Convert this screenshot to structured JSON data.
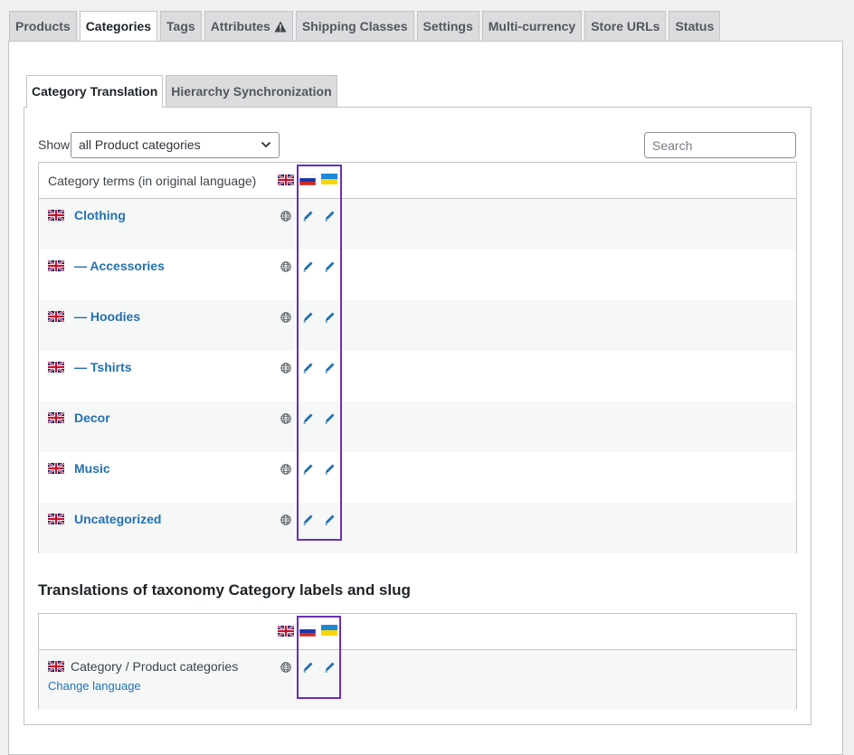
{
  "nav_tabs": [
    {
      "label": "Products",
      "active": false
    },
    {
      "label": "Categories",
      "active": true
    },
    {
      "label": "Tags",
      "active": false
    },
    {
      "label": "Attributes",
      "active": false,
      "icon": "warning-icon"
    },
    {
      "label": "Shipping Classes",
      "active": false
    },
    {
      "label": "Settings",
      "active": false
    },
    {
      "label": "Multi-currency",
      "active": false
    },
    {
      "label": "Store URLs",
      "active": false
    },
    {
      "label": "Status",
      "active": false
    }
  ],
  "sub_tabs": [
    {
      "label": "Category Translation",
      "active": true
    },
    {
      "label": "Hierarchy Synchronization",
      "active": false
    }
  ],
  "filter": {
    "show_label": "Show",
    "select_value": "all Product categories",
    "search_placeholder": "Search"
  },
  "terms_table": {
    "header": "Category terms (in original language)",
    "languages": [
      "en",
      "ru",
      "uk"
    ],
    "rows": [
      {
        "name": "Clothing"
      },
      {
        "name": "— Accessories"
      },
      {
        "name": "— Hoodies"
      },
      {
        "name": "— Tshirts"
      },
      {
        "name": "Decor"
      },
      {
        "name": "Music"
      },
      {
        "name": "Uncategorized"
      }
    ]
  },
  "labels_section": {
    "title": "Translations of taxonomy Category labels and slug",
    "row_label": "Category / Product categories",
    "change_language": "Change language"
  },
  "colors": {
    "link": "#2271b1",
    "highlight": "#6c2eb9"
  }
}
